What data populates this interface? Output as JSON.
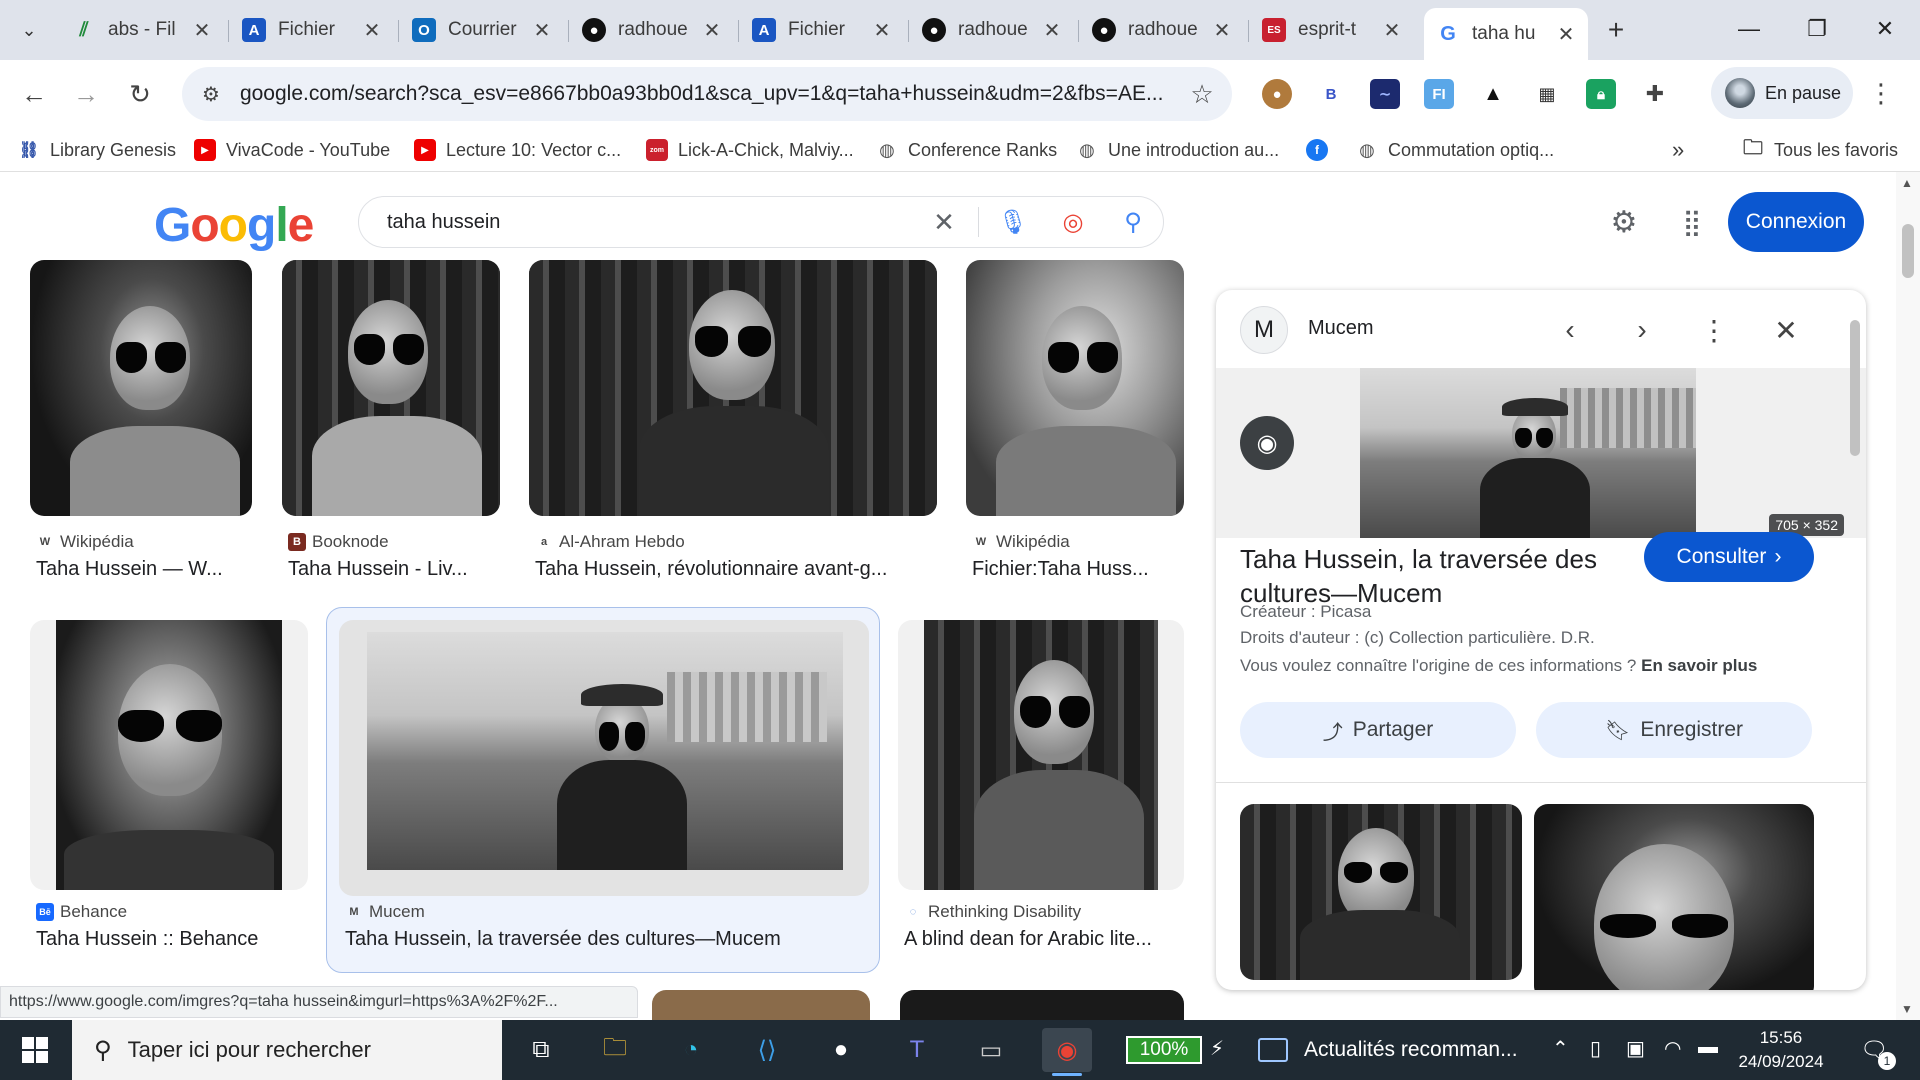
{
  "browser": {
    "tabs": [
      {
        "title": "abs - Fil",
        "favicon": "excel-icon"
      },
      {
        "title": "Fichier",
        "favicon": "drive-a-icon"
      },
      {
        "title": "Courrier",
        "favicon": "outlook-icon"
      },
      {
        "title": "radhoue",
        "favicon": "github-icon"
      },
      {
        "title": "Fichier",
        "favicon": "drive-a-icon"
      },
      {
        "title": "radhoue",
        "favicon": "github-icon"
      },
      {
        "title": "radhoue",
        "favicon": "github-icon"
      },
      {
        "title": "esprit-t",
        "favicon": "esprit-icon"
      },
      {
        "title": "taha hu",
        "favicon": "google-icon",
        "active": true
      }
    ],
    "url": "google.com/search?sca_esv=e8667bb0a93bb0d1&sca_upv=1&q=taha+hussein&udm=2&fbs=AE...",
    "profile_status": "En pause",
    "extensions": [
      "cookie-icon",
      "b-icon",
      "wave-icon",
      "fi-icon",
      "ghost-icon",
      "qr-icon",
      "lock-icon",
      "puzzle-icon"
    ],
    "bookmarks": [
      {
        "label": "Library Genesis",
        "icon": "libgen-icon"
      },
      {
        "label": "VivaCode - YouTube",
        "icon": "youtube-icon"
      },
      {
        "label": "Lecture 10: Vector c...",
        "icon": "youtube-icon"
      },
      {
        "label": "Lick-A-Chick, Malviy...",
        "icon": "zomato-icon"
      },
      {
        "label": "Conference Ranks",
        "icon": "globe-icon"
      },
      {
        "label": "Une introduction au...",
        "icon": "globe-icon"
      },
      {
        "label": "",
        "icon": "facebook-icon"
      },
      {
        "label": "Commutation optiq...",
        "icon": "globe-icon"
      }
    ],
    "all_bookmarks": "Tous les favoris",
    "status_url": "https://www.google.com/imgres?q=taha hussein&imgurl=https%3A%2F%2F..."
  },
  "google": {
    "logo": "Google",
    "query": "taha hussein",
    "signin": "Connexion"
  },
  "results": [
    {
      "source": "Wikipédia",
      "source_icon": "W",
      "title": "Taha Hussein — W..."
    },
    {
      "source": "Booknode",
      "source_icon": "B",
      "title": "Taha Hussein - Liv..."
    },
    {
      "source": "Al-Ahram Hebdo",
      "source_icon": "a",
      "title": "Taha Hussein, révolutionnaire avant-g..."
    },
    {
      "source": "Wikipédia",
      "source_icon": "W",
      "title": "Fichier:Taha Huss..."
    },
    {
      "source": "Behance",
      "source_icon": "Bē",
      "title": "Taha Hussein :: Behance"
    },
    {
      "source": "Mucem",
      "source_icon": "M",
      "title": "Taha Hussein, la traversée des cultures—Mucem"
    },
    {
      "source": "Rethinking Disability",
      "source_icon": "◌",
      "title": "A blind dean for Arabic lite..."
    }
  ],
  "panel": {
    "site": "Mucem",
    "site_letter": "M",
    "dimensions": "705 × 352",
    "title": "Taha Hussein, la traversée des cultures—Mucem",
    "visit": "Consulter",
    "creator": "Créateur : Picasa",
    "rights": "Droits d'auteur : (c) Collection particulière. D.R.",
    "origin_q": "Vous voulez connaître l'origine de ces informations ?",
    "origin_link": "En savoir plus",
    "share": "Partager",
    "save": "Enregistrer"
  },
  "taskbar": {
    "search_placeholder": "Taper ici pour rechercher",
    "battery": "100%",
    "news": "Actualités recomman...",
    "time": "15:56",
    "date": "24/09/2024",
    "notifications": "1"
  },
  "colors": {
    "accent": "#0b57d0",
    "tabstrip": "#dfe3eb",
    "taskbar": "#1f2a33"
  }
}
